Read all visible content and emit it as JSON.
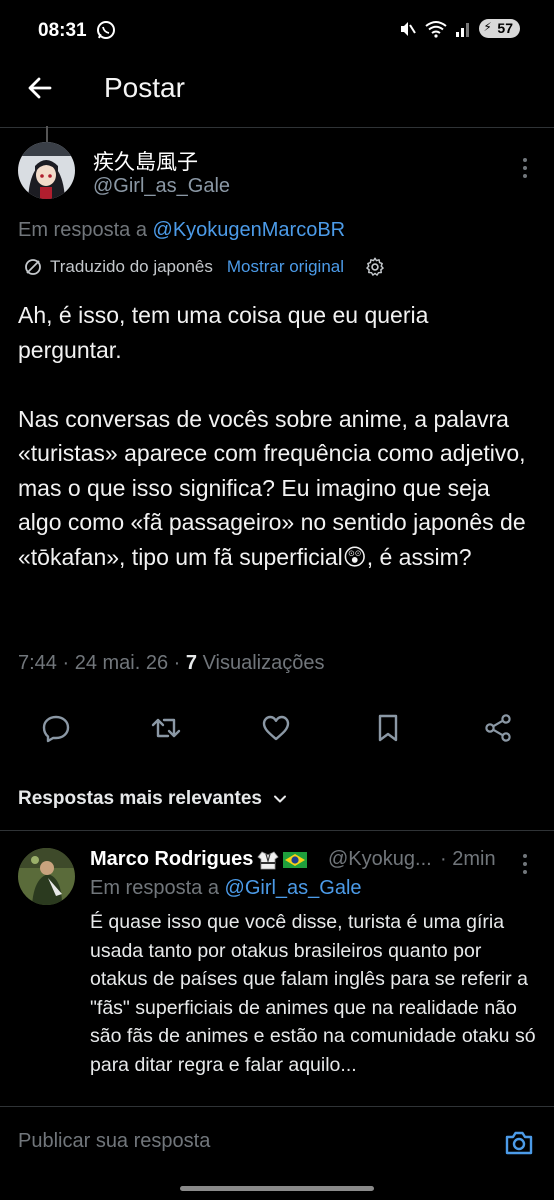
{
  "status_bar": {
    "time": "08:31",
    "battery": "57",
    "icons": [
      "whatsapp-icon",
      "mute-icon",
      "wifi-icon",
      "signal-icon",
      "battery-icon"
    ]
  },
  "header": {
    "title": "Postar",
    "back_icon": "back-arrow-icon"
  },
  "tweet": {
    "display_name": "疾久島風子",
    "handle": "@Girl_as_Gale",
    "reply_to_prefix": "Em resposta a",
    "reply_to_handle": "@KyokugenMarcoBR",
    "translated_label": "Traduzido do japonês",
    "show_original": "Mostrar original",
    "body": "Ah, é isso, tem uma coisa que eu queria perguntar.\n\nNas conversas de vocês sobre anime, a palavra «turistas» aparece com frequência como adjetivo, mas o que isso significa? Eu imagino que seja algo como «fã passageiro» no sentido japonês de «tōkafan», tipo um fã superficial😲, é assim?",
    "time_date": "7:44 · 24 mai. 26 ·",
    "views_count": "7",
    "views_label": "Visualizações"
  },
  "actions": [
    "reply-icon",
    "retweet-icon",
    "like-icon",
    "bookmark-icon",
    "share-icon"
  ],
  "replies_sort": "Respostas mais relevantes",
  "reply": {
    "display_name": "Marco Rodrigues",
    "handle": "@Kyokug...",
    "time": "· 2min",
    "reply_to_prefix": "Em resposta a",
    "reply_to_handle": "@Girl_as_Gale",
    "body": "É quase isso que você disse, turista é uma gíria usada tanto por otakus brasileiros quanto por otakus de países que falam inglês para se referir a \"fãs\" superficiais de animes que na realidade não são fãs de animes e estão na comunidade otaku só para ditar regra e falar aquilo..."
  },
  "composer": {
    "placeholder": "Publicar sua resposta"
  },
  "colors": {
    "background": "#000000",
    "link": "#4c9be8",
    "secondary_text": "#71767b",
    "divider": "#2f3336"
  }
}
